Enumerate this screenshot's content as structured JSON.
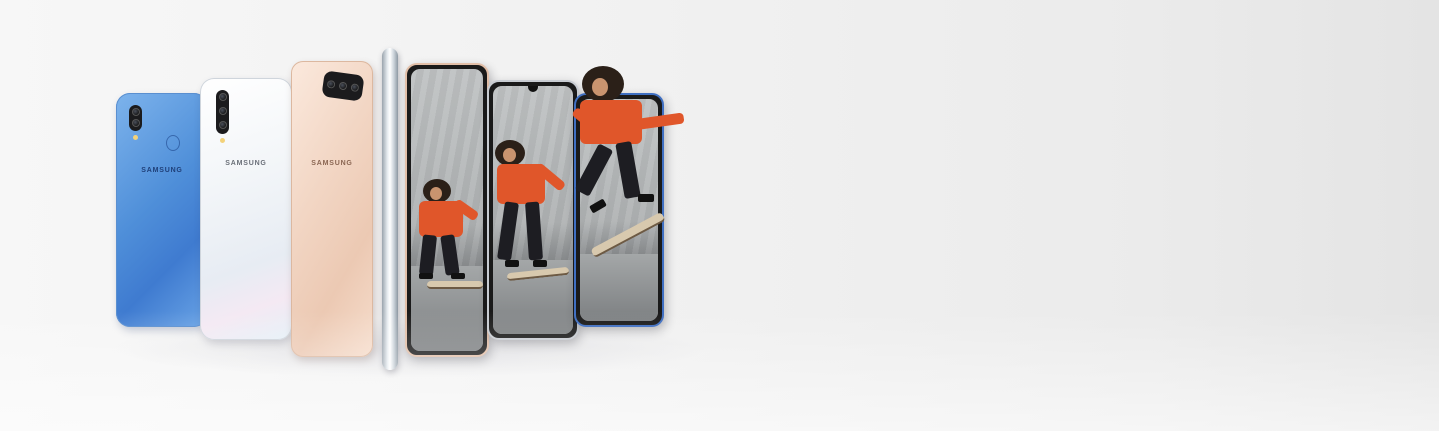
{
  "scene": {
    "description_visible_text": {
      "phone_blue_brand": "SAMSUNG",
      "phone_white_brand": "SAMSUNG",
      "phone_gold_brand": "SAMSUNG"
    },
    "colors": {
      "background": "#f1f1f1",
      "phone_blue": "#4f8fd9",
      "phone_white": "#f2f5f8",
      "phone_gold": "#f2d6c4",
      "jacket_orange": "#e0562a"
    },
    "icons": {
      "camera": "camera-lens-icon",
      "flash": "flash-icon",
      "fingerprint": "fingerprint-sensor-icon"
    }
  }
}
